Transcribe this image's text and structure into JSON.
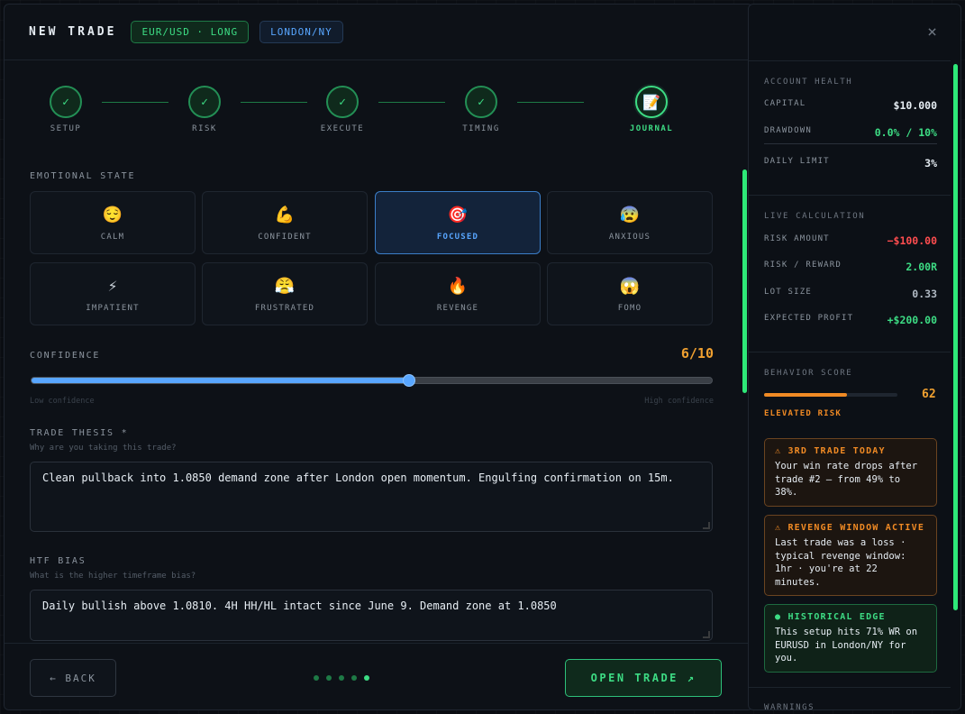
{
  "header": {
    "title": "NEW TRADE",
    "pair_badge": "EUR/USD · LONG",
    "session_badge": "LONDON/NY"
  },
  "stepper": [
    {
      "label": "SETUP",
      "icon": "✓",
      "state": "done"
    },
    {
      "label": "RISK",
      "icon": "✓",
      "state": "done"
    },
    {
      "label": "EXECUTE",
      "icon": "✓",
      "state": "done"
    },
    {
      "label": "TIMING",
      "icon": "✓",
      "state": "done"
    },
    {
      "label": "JOURNAL",
      "icon": "📝",
      "state": "active"
    }
  ],
  "emotional_state": {
    "label": "EMOTIONAL STATE",
    "options": [
      {
        "label": "CALM",
        "icon": "😌"
      },
      {
        "label": "CONFIDENT",
        "icon": "💪"
      },
      {
        "label": "FOCUSED",
        "icon": "🎯"
      },
      {
        "label": "ANXIOUS",
        "icon": "😰"
      },
      {
        "label": "IMPATIENT",
        "icon": "⚡"
      },
      {
        "label": "FRUSTRATED",
        "icon": "😤"
      },
      {
        "label": "REVENGE",
        "icon": "🔥"
      },
      {
        "label": "FOMO",
        "icon": "😱"
      }
    ],
    "selected": "FOCUSED"
  },
  "confidence": {
    "label": "CONFIDENCE",
    "value_text": "6/10",
    "value_fraction": 0.555,
    "low_label": "Low confidence",
    "high_label": "High confidence"
  },
  "trade_thesis": {
    "label": "TRADE THESIS *",
    "hint": "Why are you taking this trade?",
    "value": "Clean pullback into 1.0850 demand zone after London open momentum. Engulfing confirmation on 15m."
  },
  "htf_bias": {
    "label": "HTF BIAS",
    "hint": "What is the higher timeframe bias?",
    "value": "Daily bullish above 1.0810. 4H HH/HL intact since June 9. Demand zone at 1.0850"
  },
  "footer": {
    "back_label": "← BACK",
    "open_label": "OPEN TRADE ↗",
    "dots_total": 5,
    "dots_active": 4
  },
  "side": {
    "account_health": {
      "title": "ACCOUNT HEALTH",
      "capital_label": "CAPITAL",
      "capital_value": "$10.000",
      "drawdown_label": "DRAWDOWN",
      "drawdown_value": "0.0% / 10%",
      "daily_limit_label": "DAILY LIMIT",
      "daily_limit_value": "3%"
    },
    "live_calc": {
      "title": "LIVE CALCULATION",
      "risk_amount_label": "RISK AMOUNT",
      "risk_amount_value": "−$100.00",
      "rr_label": "RISK / REWARD",
      "rr_value": "2.00R",
      "lot_label": "LOT SIZE",
      "lot_value": "0.33",
      "profit_label": "EXPECTED PROFIT",
      "profit_value": "+$200.00"
    },
    "behavior": {
      "title": "BEHAVIOR SCORE",
      "score": "62",
      "score_fraction": 0.62,
      "level": "ELEVATED RISK"
    },
    "alerts": [
      {
        "type": "warn",
        "title": "⚠ 3RD TRADE TODAY",
        "body": "Your win rate drops after trade #2 — from 49% to 38%."
      },
      {
        "type": "warn",
        "title": "⚠ REVENGE WINDOW ACTIVE",
        "body": "Last trade was a loss · typical revenge window: 1hr · you're at 22 minutes."
      },
      {
        "type": "good",
        "title": "● HISTORICAL EDGE",
        "body": "This setup hits 71% WR on EURUSD in London/NY for you."
      }
    ],
    "warnings_title": "WARNINGS",
    "close_icon": "×"
  }
}
